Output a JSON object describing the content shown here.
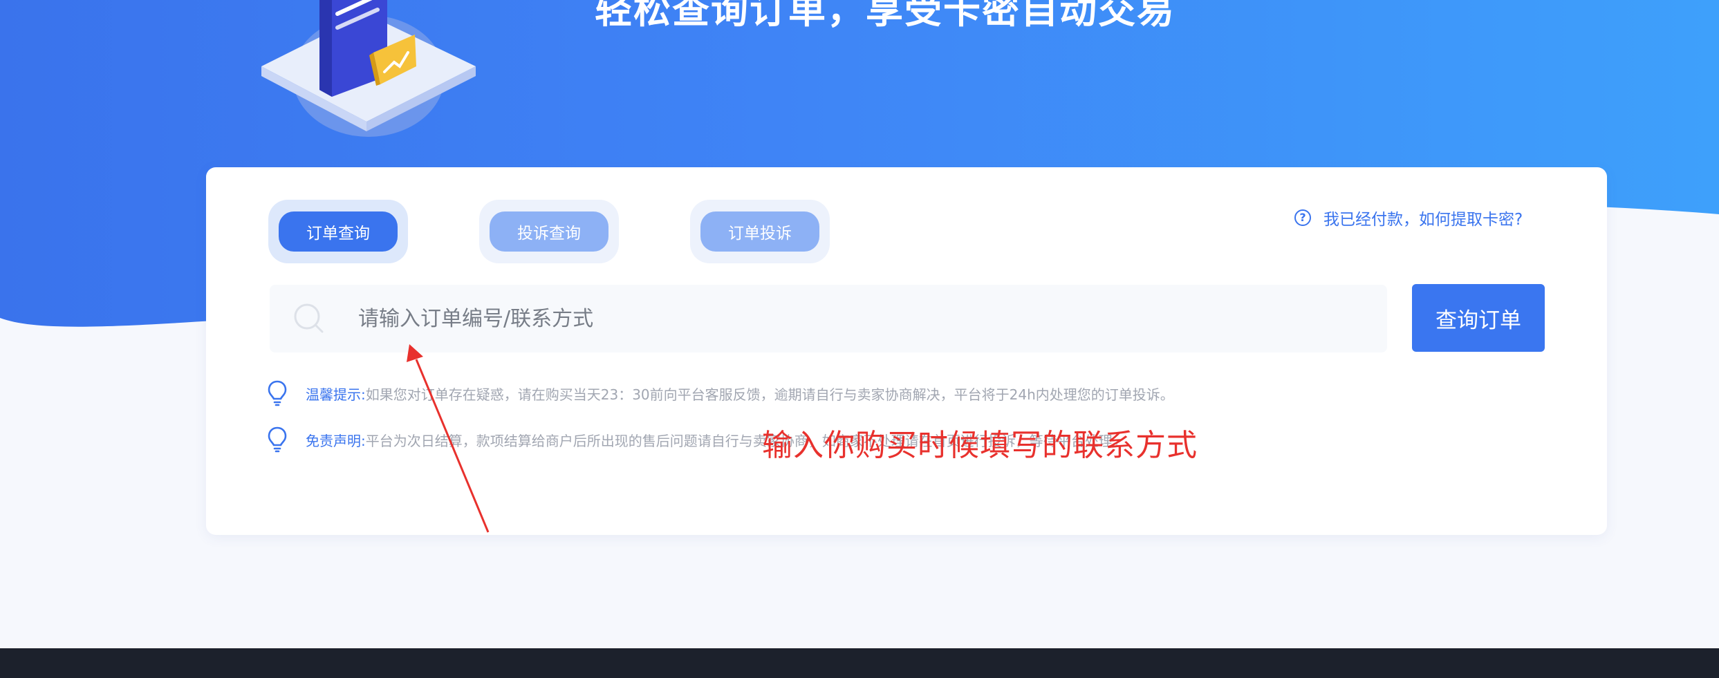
{
  "hero": {
    "title": "轻松查询订单，享受卡密自动交易"
  },
  "tabs": [
    {
      "label": "订单查询",
      "active": true
    },
    {
      "label": "投诉查询",
      "active": false
    },
    {
      "label": "订单投诉",
      "active": false
    }
  ],
  "help": {
    "icon": "question-circle-icon",
    "label": "我已经付款，如何提取卡密?"
  },
  "search": {
    "placeholder": "请输入订单编号/联系方式",
    "value": "",
    "icon": "search-icon",
    "button_label": "查询订单"
  },
  "notices": [
    {
      "icon": "lightbulb-icon",
      "label": "温馨提示:",
      "text": "如果您对订单存在疑惑，请在购买当天23：30前向平台客服反馈，逾期请自行与卖家协商解决，平台将于24h内处理您的订单投诉。"
    },
    {
      "icon": "lightbulb-icon",
      "label": "免责声明:",
      "text": "平台为次日结算，款项结算给商户后所出现的售后问题请自行与卖家协商，如商家不处理请在首页进行投诉，等待平台处理。"
    }
  ],
  "annotation": {
    "text": "输入你购买时候填写的联系方式",
    "color": "#e8312d"
  },
  "colors": {
    "accent": "#3a74ee",
    "hero_start": "#3a73ec",
    "hero_end": "#3ea0fb",
    "footer": "#1c212c"
  }
}
